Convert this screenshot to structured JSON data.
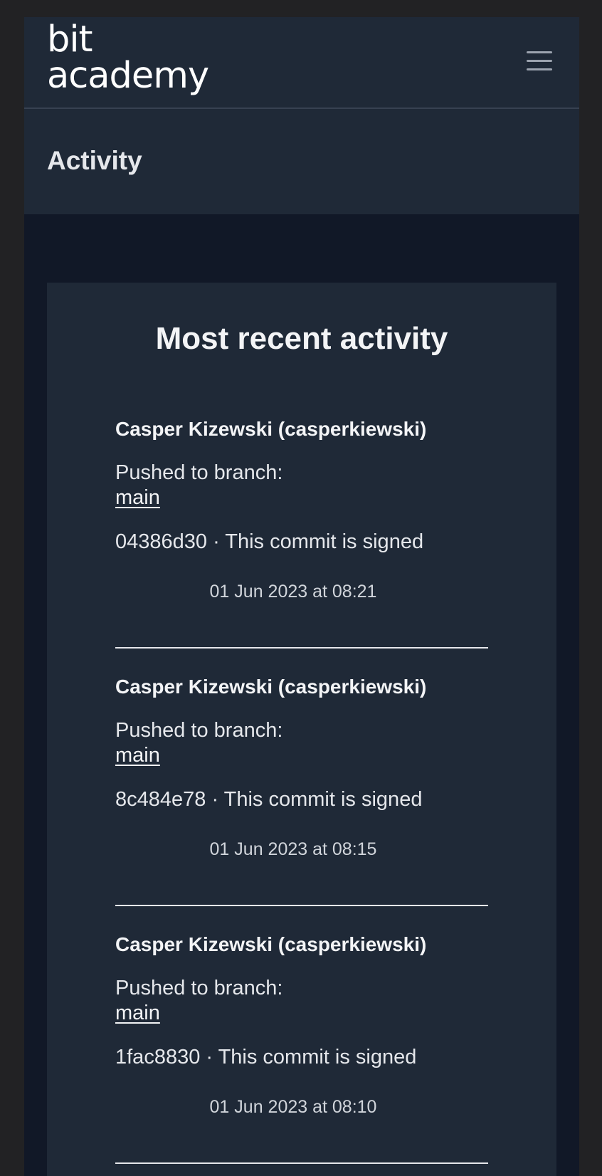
{
  "brand": {
    "line1": "bit",
    "line2": "academy"
  },
  "page_title": "Activity",
  "card_title": "Most recent activity",
  "activities": [
    {
      "user": "Casper Kizewski (casperkiewski)",
      "action": "Pushed to branch:",
      "branch": "main",
      "commit": "04386d30 · This commit is signed",
      "date": "01 Jun 2023 at 08:21"
    },
    {
      "user": "Casper Kizewski (casperkiewski)",
      "action": "Pushed to branch:",
      "branch": "main",
      "commit": "8c484e78 · This commit is signed",
      "date": "01 Jun 2023 at 08:15"
    },
    {
      "user": "Casper Kizewski (casperkiewski)",
      "action": "Pushed to branch:",
      "branch": "main",
      "commit": "1fac8830 · This commit is signed",
      "date": "01 Jun 2023 at 08:10"
    }
  ],
  "icons": {
    "menu": "hamburger-menu-icon"
  },
  "colors": {
    "background": "#111827",
    "surface": "#1f2937",
    "text": "#e5e7eb"
  }
}
